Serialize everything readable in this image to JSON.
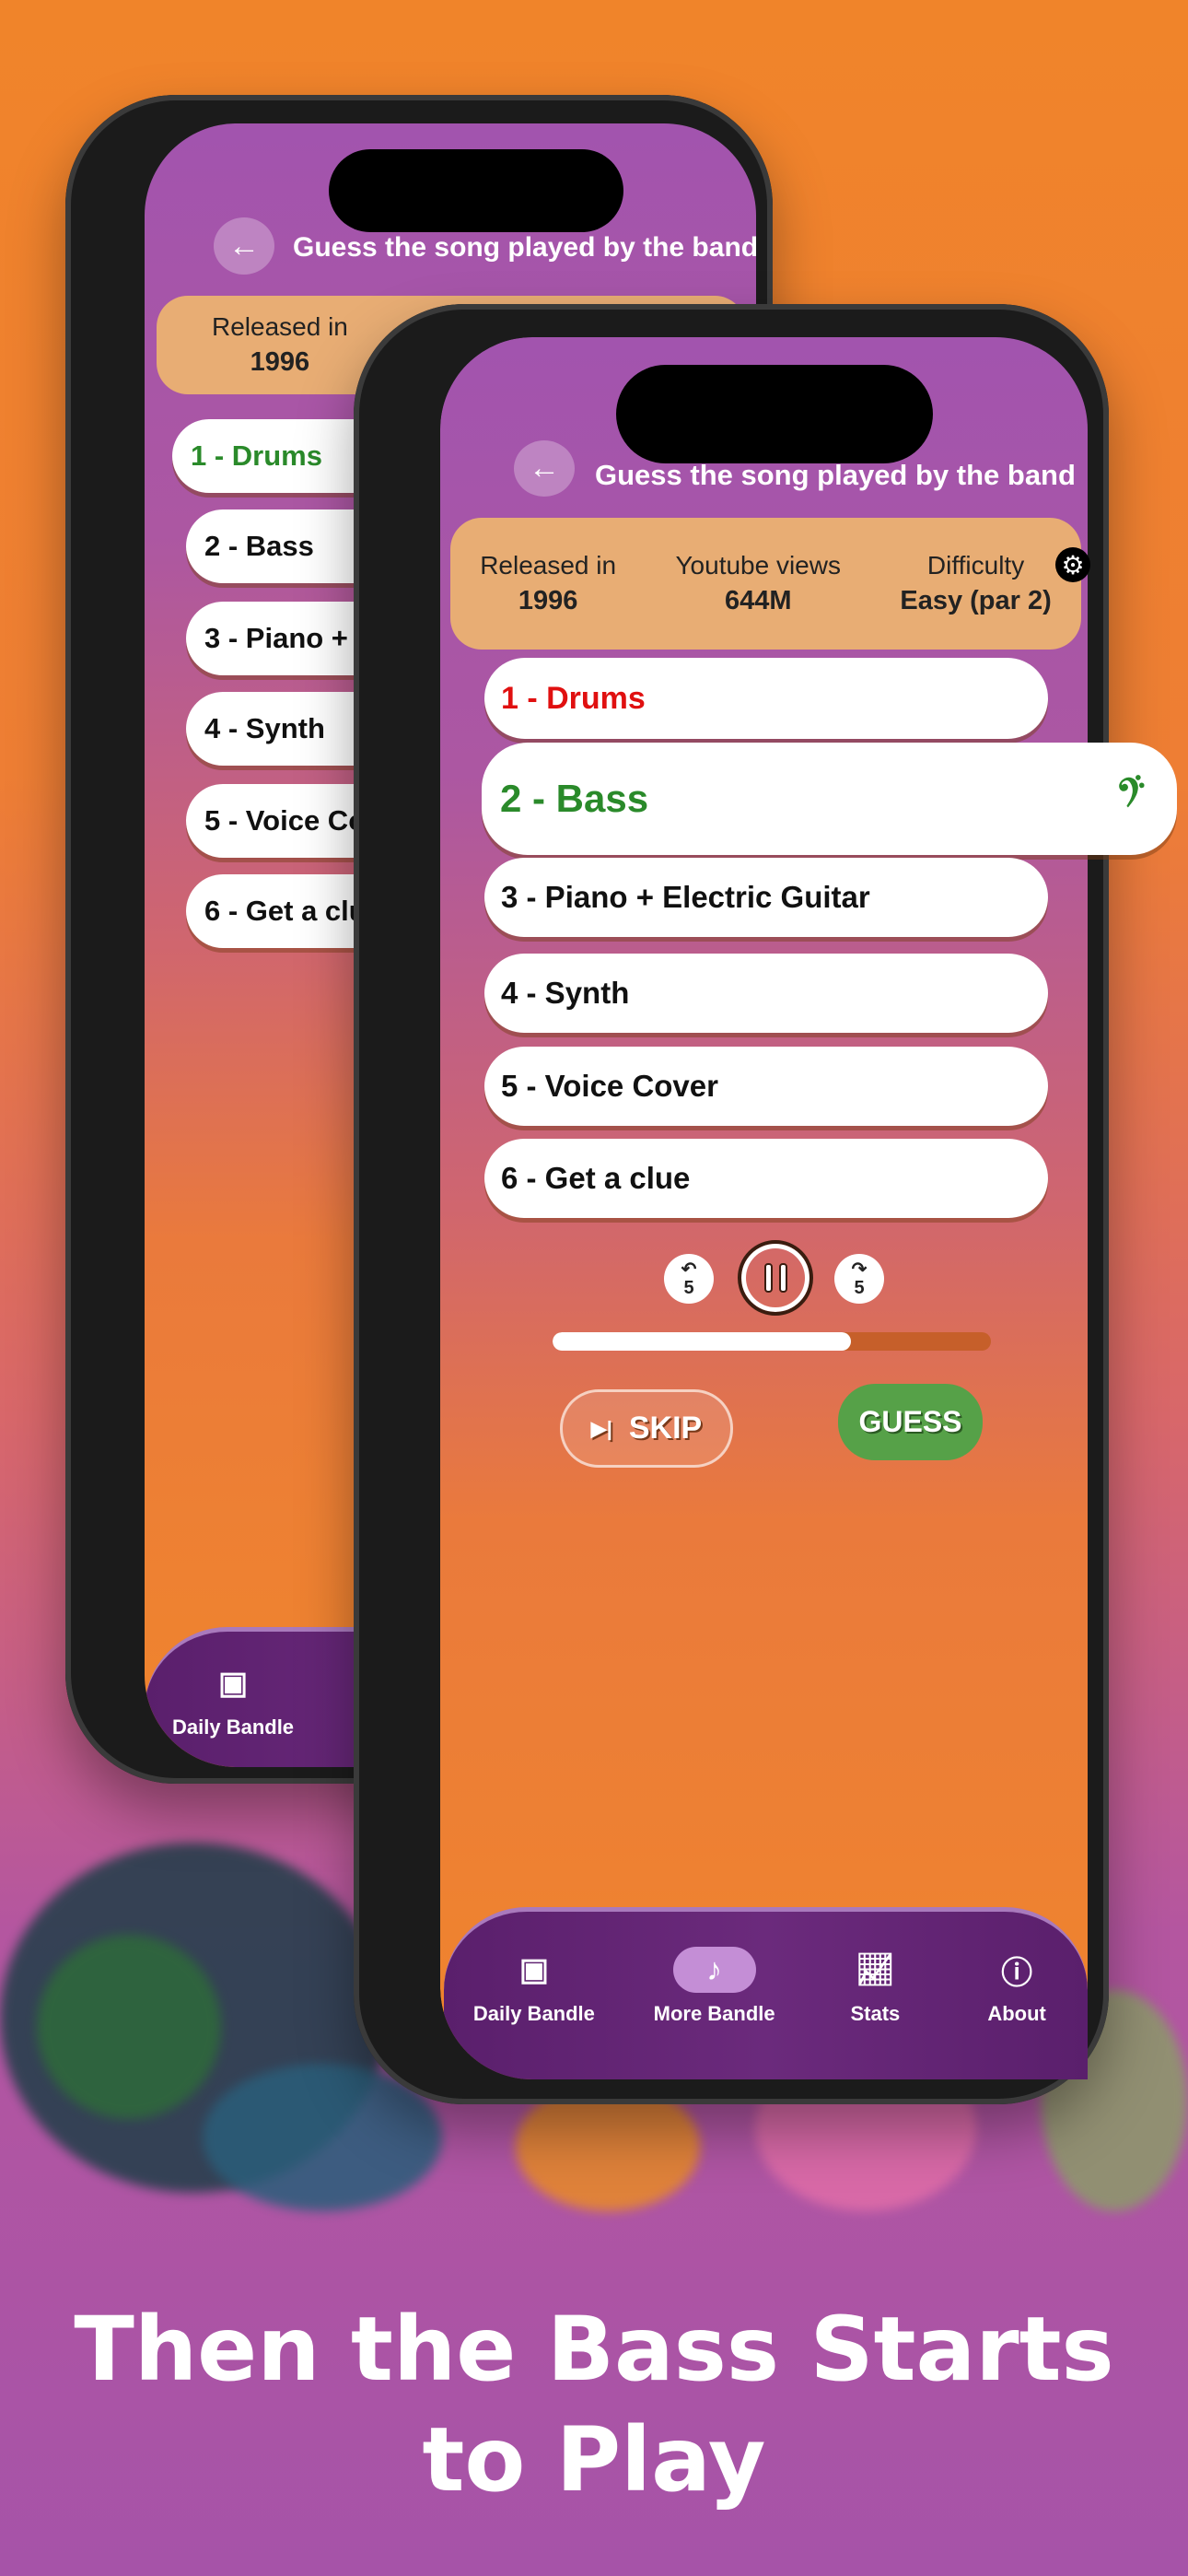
{
  "colors": {
    "accent_orange": "#F0852A",
    "accent_purple": "#A653A8",
    "stats_card": "#E8AD74",
    "nav_bg": "#5E2270",
    "correct_green": "#2A8A2A",
    "wrong_red": "#E01010",
    "guess_button": "#56A148"
  },
  "back_phone": {
    "title": "Guess the song played by the band",
    "stats": [
      {
        "label": "Released in",
        "value": "1996"
      }
    ],
    "items": [
      {
        "label": "1 - Drums",
        "state": "correct"
      },
      {
        "label": "2 - Bass"
      },
      {
        "label": "3 - Piano + Electric Guitar"
      },
      {
        "label": "4 - Synth"
      },
      {
        "label": "5 - Voice Cover"
      },
      {
        "label": "6 - Get a clue"
      }
    ],
    "nav": [
      {
        "label": "Daily Bandle",
        "icon": "calendar-icon"
      }
    ]
  },
  "front_phone": {
    "title": "Guess the song played by the band",
    "back_icon": "arrow-left-icon",
    "settings_icon": "gear-icon",
    "stats": [
      {
        "label": "Released in",
        "value": "1996"
      },
      {
        "label": "Youtube views",
        "value": "644M"
      },
      {
        "label": "Difficulty",
        "value": "Easy (par 2)"
      }
    ],
    "items": [
      {
        "label": "1 - Drums",
        "state": "wrong"
      },
      {
        "label": "2 - Bass",
        "state": "active",
        "icon": "bass-guitar-icon"
      },
      {
        "label": "3 - Piano + Electric Guitar"
      },
      {
        "label": "4 - Synth"
      },
      {
        "label": "5 - Voice Cover"
      },
      {
        "label": "6 - Get a clue"
      }
    ],
    "player": {
      "rewind_seconds": "5",
      "forward_seconds": "5",
      "state": "playing",
      "progress_percent": 68
    },
    "skip_label": "SKIP",
    "guess_label": "GUESS",
    "nav": [
      {
        "label": "Daily Bandle",
        "icon": "calendar-icon"
      },
      {
        "label": "More Bandle",
        "icon": "music-note-icon",
        "active": true
      },
      {
        "label": "Stats",
        "icon": "chart-icon"
      },
      {
        "label": "About",
        "icon": "help-icon"
      }
    ]
  },
  "caption": {
    "line1": "Then the Bass Starts",
    "line2": "to Play"
  }
}
